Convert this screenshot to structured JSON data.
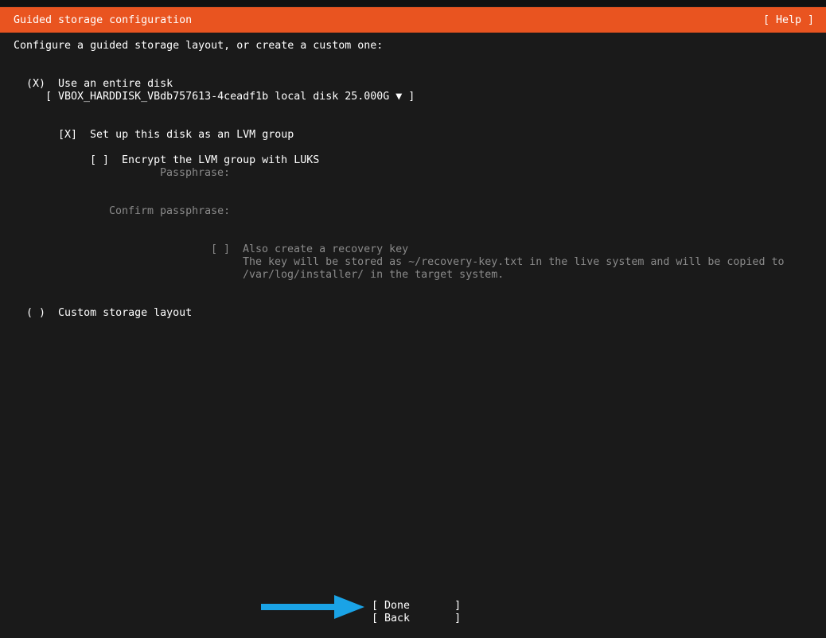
{
  "header": {
    "title": "Guided storage configuration",
    "help_button": "[ Help ]"
  },
  "intro_text": "Configure a guided storage layout, or create a custom one:",
  "entire_disk": {
    "radio": "(X)",
    "label": "Use an entire disk"
  },
  "disk_select": {
    "text": "[ VBOX_HARDDISK_VBdb757613-4ceadf1b local disk 25.000G ▼ ]"
  },
  "lvm": {
    "checkbox": "[X]",
    "label": "Set up this disk as an LVM group"
  },
  "luks": {
    "checkbox": "[ ]",
    "label": "Encrypt the LVM group with LUKS"
  },
  "passphrase": {
    "label": "Passphrase:",
    "value": ""
  },
  "confirm_passphrase": {
    "label": "Confirm passphrase:",
    "value": ""
  },
  "recovery_key": {
    "checkbox": "[ ]",
    "label": "Also create a recovery key",
    "description_line1": "The key will be stored as ~/recovery-key.txt in the live system and will be copied to",
    "description_line2": "/var/log/installer/ in the target system."
  },
  "custom_layout": {
    "radio": "( )",
    "label": "Custom storage layout"
  },
  "buttons": {
    "done": "[ Done       ]",
    "back": "[ Back       ]"
  },
  "colors": {
    "header_bg": "#e95420",
    "background": "#1a1a1a",
    "arrow": "#1aa3e6",
    "dim_text": "#8a8a8a"
  }
}
